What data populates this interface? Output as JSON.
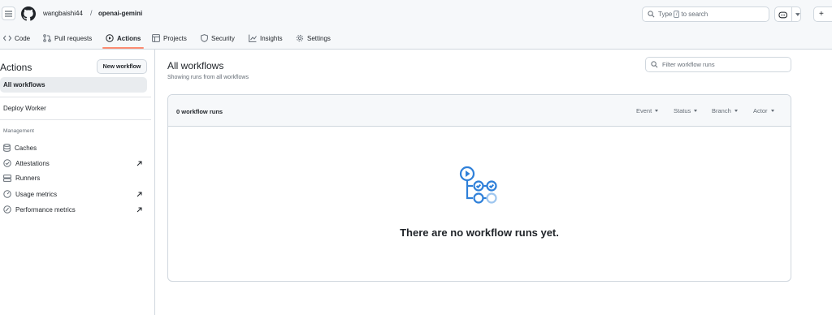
{
  "header": {
    "owner": "wangbaishi44",
    "separator": "/",
    "repo": "openai-gemini",
    "search_prefix": "Type",
    "search_key": "/",
    "search_suffix": "to search",
    "plus_label": "+"
  },
  "tabs": [
    {
      "label": "Code"
    },
    {
      "label": "Pull requests"
    },
    {
      "label": "Actions"
    },
    {
      "label": "Projects"
    },
    {
      "label": "Security"
    },
    {
      "label": "Insights"
    },
    {
      "label": "Settings"
    }
  ],
  "sidebar": {
    "title": "Actions",
    "new_workflow": "New workflow",
    "all_workflows": "All workflows",
    "workflow_item": "Deploy Worker",
    "section_label": "Management",
    "items": [
      {
        "label": "Caches"
      },
      {
        "label": "Attestations"
      },
      {
        "label": "Runners"
      },
      {
        "label": "Usage metrics"
      },
      {
        "label": "Performance metrics"
      }
    ]
  },
  "main": {
    "title": "All workflows",
    "subtitle": "Showing runs from all workflows",
    "filter_placeholder": "Filter workflow runs",
    "runs_count": "0 workflow runs",
    "filters": [
      "Event",
      "Status",
      "Branch",
      "Actor"
    ],
    "empty_message": "There are no workflow runs yet."
  },
  "colors": {
    "accent_underline": "#fd8c73",
    "blank_icon": "#2f80d9"
  }
}
